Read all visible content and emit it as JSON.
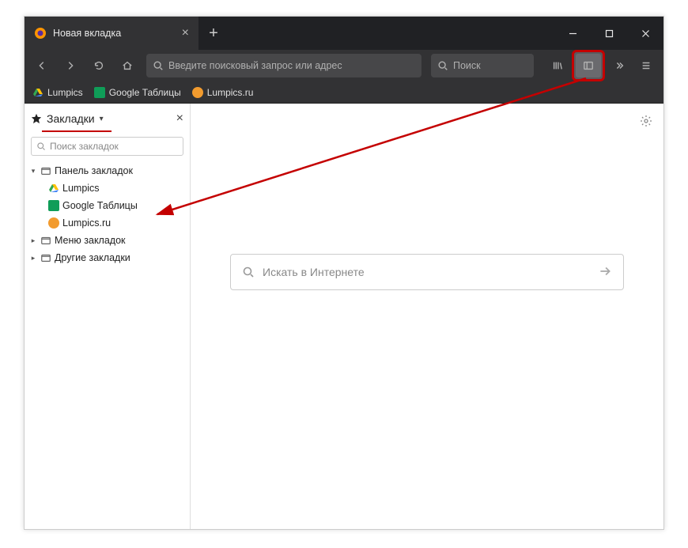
{
  "tab": {
    "title": "Новая вкладка"
  },
  "toolbar": {
    "url_placeholder": "Введите поисковый запрос или адрес",
    "search_placeholder": "Поиск"
  },
  "bookmarks_toolbar": {
    "items": [
      {
        "label": "Lumpics"
      },
      {
        "label": "Google Таблицы"
      },
      {
        "label": "Lumpics.ru"
      }
    ]
  },
  "sidebar": {
    "title": "Закладки",
    "search_placeholder": "Поиск закладок",
    "tree": {
      "panel_label": "Панель закладок",
      "panel_children": [
        {
          "label": "Lumpics"
        },
        {
          "label": "Google Таблицы"
        },
        {
          "label": "Lumpics.ru"
        }
      ],
      "menu_label": "Меню закладок",
      "other_label": "Другие закладки"
    }
  },
  "newtab": {
    "search_placeholder": "Искать в Интернете"
  },
  "colors": {
    "annotation": "#c40000",
    "sheets_green": "#0f9d58",
    "drive_yellow": "#ffc107",
    "drive_green": "#34a853",
    "drive_blue": "#4285f4",
    "orange": "#f29b2e"
  }
}
